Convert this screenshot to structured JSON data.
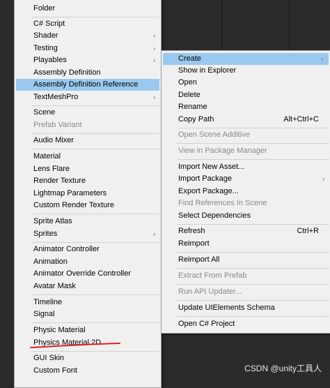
{
  "left_menu": {
    "items": [
      {
        "label": "Folder",
        "arrow": false,
        "disabled": false,
        "highlight": false
      },
      {
        "label": "C# Script",
        "arrow": false,
        "disabled": false,
        "highlight": false
      },
      {
        "label": "Shader",
        "arrow": true,
        "disabled": false,
        "highlight": false
      },
      {
        "label": "Testing",
        "arrow": true,
        "disabled": false,
        "highlight": false
      },
      {
        "label": "Playables",
        "arrow": true,
        "disabled": false,
        "highlight": false
      },
      {
        "label": "Assembly Definition",
        "arrow": false,
        "disabled": false,
        "highlight": false
      },
      {
        "label": "Assembly Definition Reference",
        "arrow": false,
        "disabled": false,
        "highlight": true
      },
      {
        "label": "TextMeshPro",
        "arrow": true,
        "disabled": false,
        "highlight": false
      },
      {
        "label": "Scene",
        "arrow": false,
        "disabled": false,
        "highlight": false
      },
      {
        "label": "Prefab Variant",
        "arrow": false,
        "disabled": true,
        "highlight": false
      },
      {
        "label": "Audio Mixer",
        "arrow": false,
        "disabled": false,
        "highlight": false
      },
      {
        "label": "Material",
        "arrow": false,
        "disabled": false,
        "highlight": false
      },
      {
        "label": "Lens Flare",
        "arrow": false,
        "disabled": false,
        "highlight": false
      },
      {
        "label": "Render Texture",
        "arrow": false,
        "disabled": false,
        "highlight": false
      },
      {
        "label": "Lightmap Parameters",
        "arrow": false,
        "disabled": false,
        "highlight": false
      },
      {
        "label": "Custom Render Texture",
        "arrow": false,
        "disabled": false,
        "highlight": false
      },
      {
        "label": "Sprite Atlas",
        "arrow": false,
        "disabled": false,
        "highlight": false
      },
      {
        "label": "Sprites",
        "arrow": true,
        "disabled": false,
        "highlight": false
      },
      {
        "label": "Animator Controller",
        "arrow": false,
        "disabled": false,
        "highlight": false
      },
      {
        "label": "Animation",
        "arrow": false,
        "disabled": false,
        "highlight": false
      },
      {
        "label": "Animator Override Controller",
        "arrow": false,
        "disabled": false,
        "highlight": false
      },
      {
        "label": "Avatar Mask",
        "arrow": false,
        "disabled": false,
        "highlight": false
      },
      {
        "label": "Timeline",
        "arrow": false,
        "disabled": false,
        "highlight": false
      },
      {
        "label": "Signal",
        "arrow": false,
        "disabled": false,
        "highlight": false
      },
      {
        "label": "Physic Material",
        "arrow": false,
        "disabled": false,
        "highlight": false
      },
      {
        "label": "Physics Material 2D",
        "arrow": false,
        "disabled": false,
        "highlight": false
      },
      {
        "label": "GUI Skin",
        "arrow": false,
        "disabled": false,
        "highlight": false
      },
      {
        "label": "Custom Font",
        "arrow": false,
        "disabled": false,
        "highlight": false
      }
    ]
  },
  "right_menu": {
    "items": [
      {
        "label": "Create",
        "shortcut": "",
        "arrow": true,
        "disabled": false,
        "highlight": true
      },
      {
        "label": "Show in Explorer",
        "shortcut": "",
        "arrow": false,
        "disabled": false,
        "highlight": false
      },
      {
        "label": "Open",
        "shortcut": "",
        "arrow": false,
        "disabled": false,
        "highlight": false
      },
      {
        "label": "Delete",
        "shortcut": "",
        "arrow": false,
        "disabled": false,
        "highlight": false
      },
      {
        "label": "Rename",
        "shortcut": "",
        "arrow": false,
        "disabled": false,
        "highlight": false
      },
      {
        "label": "Copy Path",
        "shortcut": "Alt+Ctrl+C",
        "arrow": false,
        "disabled": false,
        "highlight": false
      },
      {
        "label": "Open Scene Additive",
        "shortcut": "",
        "arrow": false,
        "disabled": true,
        "highlight": false
      },
      {
        "label": "View in Package Manager",
        "shortcut": "",
        "arrow": false,
        "disabled": true,
        "highlight": false
      },
      {
        "label": "Import New Asset...",
        "shortcut": "",
        "arrow": false,
        "disabled": false,
        "highlight": false
      },
      {
        "label": "Import Package",
        "shortcut": "",
        "arrow": true,
        "disabled": false,
        "highlight": false
      },
      {
        "label": "Export Package...",
        "shortcut": "",
        "arrow": false,
        "disabled": false,
        "highlight": false
      },
      {
        "label": "Find References In Scene",
        "shortcut": "",
        "arrow": false,
        "disabled": true,
        "highlight": false
      },
      {
        "label": "Select Dependencies",
        "shortcut": "",
        "arrow": false,
        "disabled": false,
        "highlight": false
      },
      {
        "label": "Refresh",
        "shortcut": "Ctrl+R",
        "arrow": false,
        "disabled": false,
        "highlight": false
      },
      {
        "label": "Reimport",
        "shortcut": "",
        "arrow": false,
        "disabled": false,
        "highlight": false
      },
      {
        "label": "Reimport All",
        "shortcut": "",
        "arrow": false,
        "disabled": false,
        "highlight": false
      },
      {
        "label": "Extract From Prefab",
        "shortcut": "",
        "arrow": false,
        "disabled": true,
        "highlight": false
      },
      {
        "label": "Run API Updater...",
        "shortcut": "",
        "arrow": false,
        "disabled": true,
        "highlight": false
      },
      {
        "label": "Update UIElements Schema",
        "shortcut": "",
        "arrow": false,
        "disabled": false,
        "highlight": false
      },
      {
        "label": "Open C# Project",
        "shortcut": "",
        "arrow": false,
        "disabled": false,
        "highlight": false
      }
    ]
  },
  "arrow_glyph": "›",
  "annotation_color": "#e02020",
  "highlight_color": "#99c9ef",
  "watermark": "CSDN @unity工具人"
}
